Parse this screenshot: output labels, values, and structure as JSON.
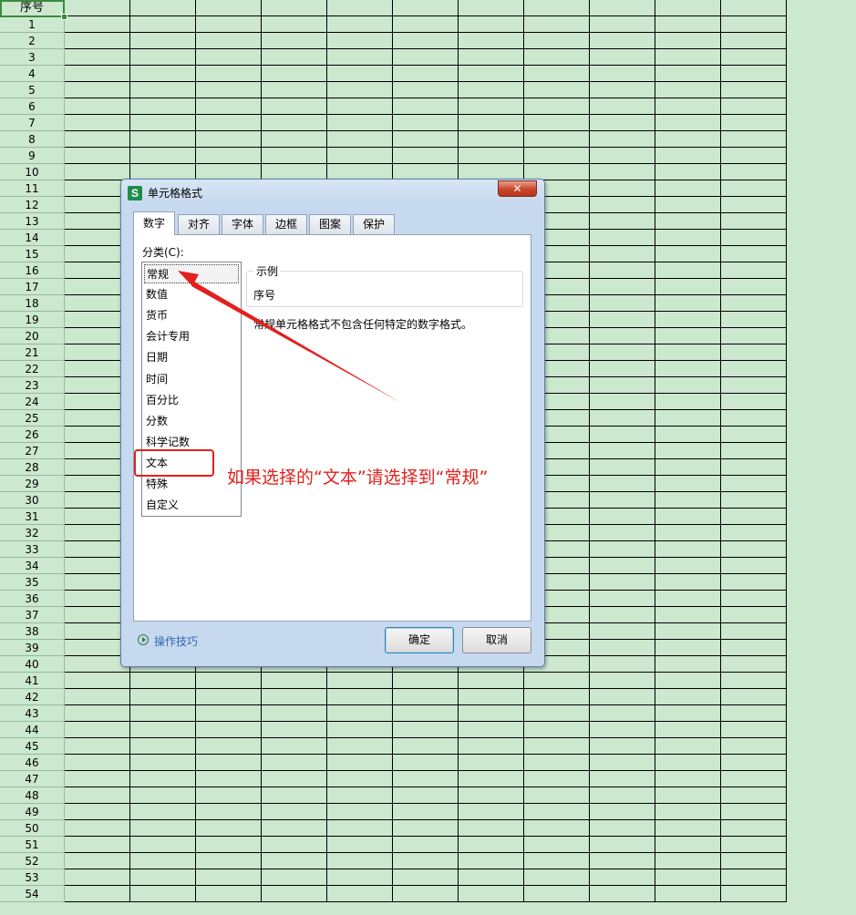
{
  "sheet": {
    "header_label": "序号",
    "row_numbers": [
      "1",
      "2",
      "3",
      "4",
      "5",
      "6",
      "7",
      "8",
      "9",
      "10",
      "11",
      "12",
      "13",
      "14",
      "15",
      "16",
      "17",
      "18",
      "19",
      "20",
      "21",
      "22",
      "23",
      "24",
      "25",
      "26",
      "27",
      "28",
      "29",
      "30",
      "31",
      "32",
      "33",
      "34",
      "35",
      "36",
      "37",
      "38",
      "39",
      "40",
      "41",
      "42",
      "43",
      "44",
      "45",
      "46",
      "47",
      "48",
      "49",
      "50",
      "51",
      "52",
      "53",
      "54"
    ]
  },
  "dialog": {
    "title": "单元格格式",
    "close_label": "✕",
    "tabs": [
      {
        "label": "数字",
        "active": true
      },
      {
        "label": "对齐",
        "active": false
      },
      {
        "label": "字体",
        "active": false
      },
      {
        "label": "边框",
        "active": false
      },
      {
        "label": "图案",
        "active": false
      },
      {
        "label": "保护",
        "active": false
      }
    ],
    "category_label": "分类(C):",
    "categories": [
      "常规",
      "数值",
      "货币",
      "会计专用",
      "日期",
      "时间",
      "百分比",
      "分数",
      "科学记数",
      "文本",
      "特殊",
      "自定义"
    ],
    "selected_category": "常规",
    "sample_legend": "示例",
    "sample_value": "序号",
    "description": "常规单元格格式不包含任何特定的数字格式。",
    "tips_label": "操作技巧",
    "ok_label": "确定",
    "cancel_label": "取消"
  },
  "annotation": {
    "text": "如果选择的“文本”请选择到“常规”",
    "color": "#e2201d"
  },
  "colors": {
    "sheet_background": "#cce8cf",
    "selection": "#3b8a3e"
  }
}
